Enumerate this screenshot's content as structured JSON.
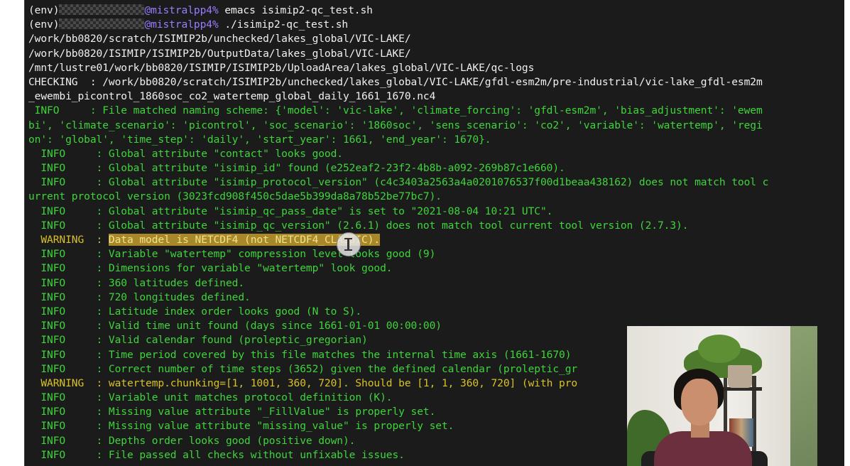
{
  "terminal": {
    "lines": [
      {
        "color": "w",
        "prefix": "(env)",
        "masked": true,
        "user": "@mistralpp4%",
        "text": " emacs isimip2-qc_test.sh"
      },
      {
        "color": "w",
        "prefix": "(env)",
        "masked": true,
        "user": "@mistralpp4%",
        "text": " ./isimip2-qc_test.sh"
      },
      {
        "color": "w",
        "text": "/work/bb0820/scratch/ISIMIP2b/unchecked/lakes_global/VIC-LAKE/"
      },
      {
        "color": "w",
        "text": "/work/bb0820/ISIMIP/ISIMIP2b/OutputData/lakes_global/VIC-LAKE/"
      },
      {
        "color": "w",
        "text": "/mnt/lustre01/work/bb0820/ISIMIP/ISIMIP2b/UploadArea/lakes_global/VIC-LAKE/qc-logs"
      },
      {
        "color": "w",
        "text": "CHECKING  : /work/bb0820/scratch/ISIMIP2b/unchecked/lakes_global/VIC-LAKE/gfdl-esm2m/pre-industrial/vic-lake_gfdl-esm2m"
      },
      {
        "color": "w",
        "text": "_ewembi_picontrol_1860soc_co2_watertemp_global_daily_1661_1670.nc4"
      },
      {
        "color": "g",
        "text": " INFO     : File matched naming scheme: {'model': 'vic-lake', 'climate_forcing': 'gfdl-esm2m', 'bias_adjustment': 'ewem"
      },
      {
        "color": "g",
        "text": "bi', 'climate_scenario': 'picontrol', 'soc_scenario': '1860soc', 'sens_scenario': 'co2', 'variable': 'watertemp', 'regi"
      },
      {
        "color": "g",
        "text": "on': 'global', 'time_step': 'daily', 'start_year': 1661, 'end_year': 1670}."
      },
      {
        "color": "g",
        "text": "  INFO     : Global attribute \"contact\" looks good."
      },
      {
        "color": "g",
        "text": "  INFO     : Global attribute \"isimip_id\" found (e252eaf2-23f2-4b8b-a092-269b87c1e660)."
      },
      {
        "color": "g",
        "text": "  INFO     : Global attribute \"isimip_protocol_version\" (c4c3403a2563a4a0201076537f00d1beaa438162) does not match tool c"
      },
      {
        "color": "g",
        "text": "urrent protocol version (3023fcd908f450c5dae5b399da8a78b52be77bc7)."
      },
      {
        "color": "g",
        "text": "  INFO     : Global attribute \"isimip_qc_pass_date\" is set to \"2021-08-04 10:21 UTC\"."
      },
      {
        "color": "g",
        "text": "  INFO     : Global attribute \"isimip_qc_version\" (2.6.1) does not match tool current tool version (2.7.3)."
      },
      {
        "color": "y",
        "highlight": true,
        "head": "  WARNING  : ",
        "text": "Data model is NETCDF4 (not NETCDF4_CLASSIC)."
      },
      {
        "color": "g",
        "text": "  INFO     : Variable \"watertemp\" compression level looks good (9)"
      },
      {
        "color": "g",
        "text": "  INFO     : Dimensions for variable \"watertemp\" look good."
      },
      {
        "color": "g",
        "text": "  INFO     : 360 latitudes defined."
      },
      {
        "color": "g",
        "text": "  INFO     : 720 longitudes defined."
      },
      {
        "color": "g",
        "text": "  INFO     : Latitude index order looks good (N to S)."
      },
      {
        "color": "g",
        "text": "  INFO     : Valid time unit found (days since 1661-01-01 00:00:00)"
      },
      {
        "color": "g",
        "text": "  INFO     : Valid calendar found (proleptic_gregorian)"
      },
      {
        "color": "g",
        "text": "  INFO     : Time period covered by this file matches the internal time axis (1661-1670)"
      },
      {
        "color": "g",
        "text": "  INFO     : Correct number of time steps (3652) given the defined calendar (proleptic_gr"
      },
      {
        "color": "y",
        "text": "  WARNING  : watertemp.chunking=[1, 1001, 360, 720]. Should be [1, 1, 360, 720] (with pro"
      },
      {
        "color": "g",
        "text": "  INFO     : Variable unit matches protocol definition (K)."
      },
      {
        "color": "g",
        "text": "  INFO     : Missing value attribute \"_FillValue\" is properly set."
      },
      {
        "color": "g",
        "text": "  INFO     : Missing value attribute \"missing_value\" is properly set."
      },
      {
        "color": "g",
        "text": "  INFO     : Depths order looks good (positive down)."
      },
      {
        "color": "g",
        "text": "  INFO     : File passed all checks without unfixable issues."
      }
    ]
  },
  "colors": {
    "background": "#1b1b1b",
    "info": "#3fd43b",
    "warning": "#d8c12a",
    "prompt_user": "#9a7dff"
  },
  "icons": {
    "cursor": "text-cursor-icon"
  }
}
